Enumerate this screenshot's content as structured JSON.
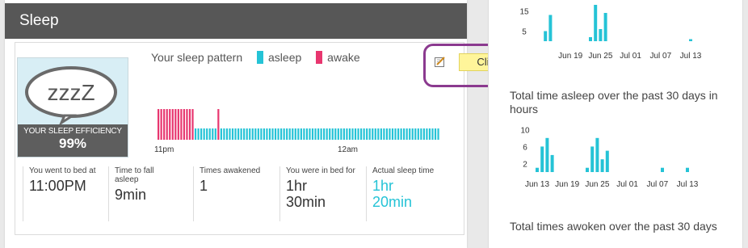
{
  "card": {
    "title": "Sleep"
  },
  "badge": {
    "art_text": "zzzZ",
    "efficiency_label": "YOUR SLEEP EFFICIENCY",
    "efficiency_value": "99%"
  },
  "legend": {
    "title": "Your sleep pattern",
    "asleep_label": "asleep",
    "awake_label": "awake",
    "asleep_color": "#25c3d6",
    "awake_color": "#e8366f"
  },
  "edit": {
    "button_label": "Click to edit",
    "icon": "pencil-icon"
  },
  "pattern": {
    "ticks": [
      "11pm",
      "12am"
    ],
    "states": [
      "awake",
      "awake",
      "awake",
      "awake",
      "awake",
      "awake",
      "awake",
      "awake",
      "awake",
      "awake",
      "awake",
      "awake",
      "awake",
      "asleep",
      "asleep",
      "asleep",
      "asleep",
      "asleep",
      "asleep",
      "asleep",
      "asleep",
      "awake",
      "asleep",
      "asleep",
      "asleep",
      "asleep",
      "asleep",
      "asleep",
      "asleep",
      "asleep",
      "asleep",
      "asleep",
      "asleep",
      "asleep",
      "asleep",
      "asleep",
      "asleep",
      "asleep",
      "asleep",
      "asleep",
      "asleep",
      "asleep",
      "asleep",
      "asleep",
      "asleep",
      "asleep",
      "asleep",
      "asleep",
      "asleep",
      "asleep",
      "asleep",
      "asleep",
      "asleep",
      "asleep",
      "asleep",
      "asleep",
      "asleep",
      "asleep",
      "asleep",
      "asleep",
      "asleep",
      "asleep",
      "asleep",
      "asleep",
      "asleep",
      "asleep",
      "asleep",
      "asleep",
      "asleep",
      "asleep",
      "asleep",
      "asleep",
      "asleep",
      "asleep",
      "asleep",
      "asleep",
      "asleep",
      "asleep",
      "asleep",
      "asleep",
      "asleep",
      "asleep",
      "asleep",
      "asleep",
      "asleep",
      "asleep",
      "asleep",
      "asleep",
      "asleep",
      "asleep",
      "asleep",
      "asleep",
      "asleep",
      "asleep",
      "asleep",
      "asleep",
      "asleep",
      "asleep",
      "asleep"
    ]
  },
  "stats": [
    {
      "label": "You went to bed at",
      "value": "11:00PM",
      "highlight": false
    },
    {
      "label": "Time to fall asleep",
      "value": "9min",
      "highlight": false
    },
    {
      "label": "Times awakened",
      "value": "1",
      "highlight": false
    },
    {
      "label": "You were in bed for",
      "value": "1hr 30min",
      "highlight": false
    },
    {
      "label": "Actual sleep time",
      "value": "1hr 20min",
      "highlight": true
    }
  ],
  "chart_data": [
    {
      "type": "bar",
      "title": "",
      "yticks": [
        15,
        5
      ],
      "xticks": [
        "Jun 19",
        "Jun 25",
        "Jul 01",
        "Jul 07",
        "Jul 13"
      ],
      "color": "#25c3d6",
      "ylim": [
        0,
        20
      ],
      "bars": [
        {
          "x": "Jun 14",
          "y": 5
        },
        {
          "x": "Jun 15",
          "y": 13
        },
        {
          "x": "Jun 23",
          "y": 2
        },
        {
          "x": "Jun 24",
          "y": 18
        },
        {
          "x": "Jun 25",
          "y": 6
        },
        {
          "x": "Jun 26",
          "y": 14
        },
        {
          "x": "Jul 13",
          "y": 1
        }
      ]
    },
    {
      "type": "bar",
      "title": "Total time asleep over the past 30 days in hours",
      "yticks": [
        10,
        6,
        2
      ],
      "xticks": [
        "Jun 13",
        "Jun 19",
        "Jun 25",
        "Jul 01",
        "Jul 07",
        "Jul 13"
      ],
      "color": "#25c3d6",
      "ylim": [
        0,
        11
      ],
      "bars": [
        {
          "x": "Jun 13",
          "y": 1
        },
        {
          "x": "Jun 14",
          "y": 6
        },
        {
          "x": "Jun 15",
          "y": 8
        },
        {
          "x": "Jun 16",
          "y": 4
        },
        {
          "x": "Jun 23",
          "y": 1
        },
        {
          "x": "Jun 24",
          "y": 6
        },
        {
          "x": "Jun 25",
          "y": 8
        },
        {
          "x": "Jun 26",
          "y": 3
        },
        {
          "x": "Jun 27",
          "y": 5
        },
        {
          "x": "Jul 08",
          "y": 1
        },
        {
          "x": "Jul 13",
          "y": 1
        }
      ]
    },
    {
      "type": "bar",
      "title": "Total times awoken over the past 30 days",
      "bars": []
    }
  ]
}
